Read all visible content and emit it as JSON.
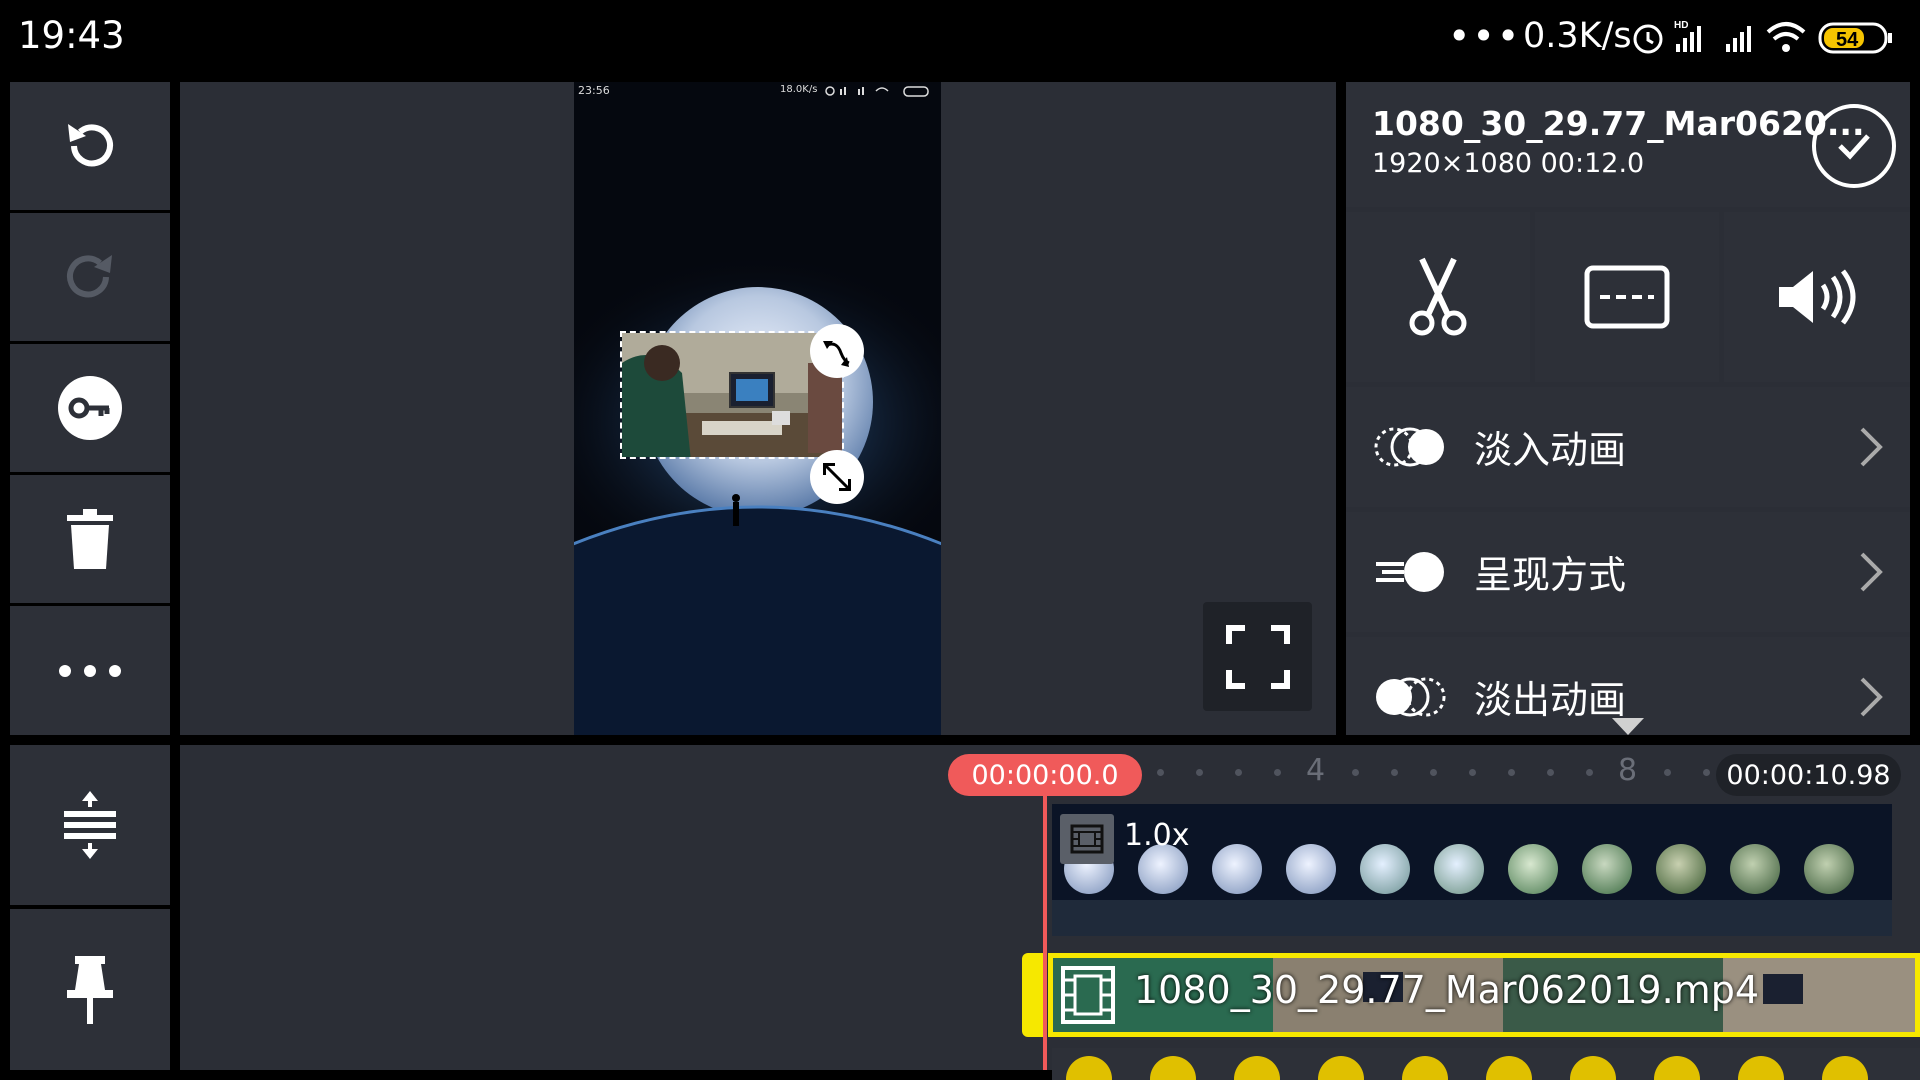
{
  "status_bar": {
    "time": "19:43",
    "dots": "•••",
    "network_speed": "0.3K/s",
    "battery": "54"
  },
  "preview": {
    "inner_time": "23:56",
    "inner_speed": "18.0K/s"
  },
  "clip": {
    "name": "1080_30_29.77_Mar0620...",
    "info": "1920×1080  00:12.0"
  },
  "menu": [
    {
      "label": "淡入动画",
      "icon": "fade-in-icon"
    },
    {
      "label": "呈现方式",
      "icon": "present-mode-icon"
    },
    {
      "label": "淡出动画",
      "icon": "fade-out-icon"
    }
  ],
  "timeline": {
    "start_time": "00:00:00.0",
    "end_time": "00:00:10.98",
    "ruler_marks": [
      "4",
      "8"
    ],
    "overlay_speed": "1.0x",
    "video_filename": "1080_30_29.77_Mar062019.mp4"
  },
  "colors": {
    "accent_red": "#f05a5a",
    "selection_yellow": "#f6e800",
    "panel_bg": "#2d3038"
  }
}
